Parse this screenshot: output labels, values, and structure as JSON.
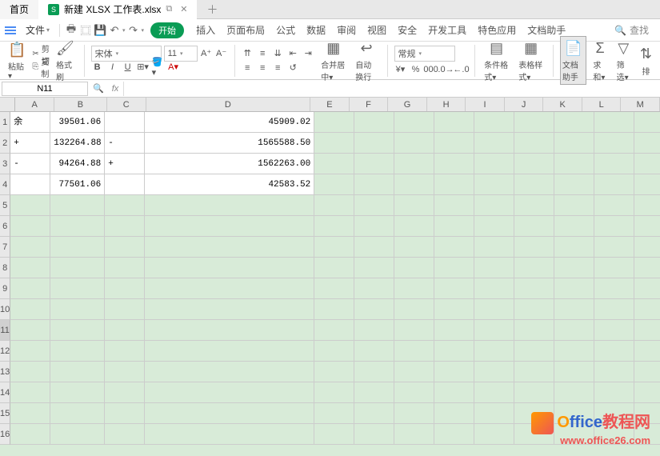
{
  "tabs": {
    "home": "首页",
    "file": "新建 XLSX 工作表.xlsx",
    "icon_letter": "S"
  },
  "menu": {
    "file": "文件",
    "start": "开始",
    "items": [
      "插入",
      "页面布局",
      "公式",
      "数据",
      "审阅",
      "视图",
      "安全",
      "开发工具",
      "特色应用",
      "文档助手"
    ],
    "search": "查找"
  },
  "toolbar": {
    "paste": "粘贴",
    "cut": "剪切",
    "copy": "复制",
    "format_painter": "格式刷",
    "font_name": "宋体",
    "font_size": "11",
    "merge": "合并居中",
    "wrap": "自动换行",
    "numfmt": "常规",
    "cond": "条件格式",
    "tablestyle": "表格样式",
    "dochelper": "文档助手",
    "sum": "求和",
    "filter": "筛选",
    "sort": "排"
  },
  "namebox": "N11",
  "fx_label": "fx",
  "colwidths": {
    "A": 50,
    "B": 68,
    "C": 50,
    "D": 212,
    "other": 50
  },
  "columns": [
    "A",
    "B",
    "C",
    "D",
    "E",
    "F",
    "G",
    "H",
    "I",
    "J",
    "K",
    "L",
    "M"
  ],
  "rows_shown": 16,
  "data_rows": 4,
  "selected_row": 11,
  "chart_data": {
    "type": "table",
    "cells": [
      {
        "r": 1,
        "c": "A",
        "v": "余",
        "t": "txt"
      },
      {
        "r": 1,
        "c": "B",
        "v": "39501.06",
        "t": "num"
      },
      {
        "r": 1,
        "c": "D",
        "v": "45909.02",
        "t": "num"
      },
      {
        "r": 2,
        "c": "A",
        "v": "+",
        "t": "txt"
      },
      {
        "r": 2,
        "c": "B",
        "v": "132264.88",
        "t": "num"
      },
      {
        "r": 2,
        "c": "C",
        "v": "-",
        "t": "txt"
      },
      {
        "r": 2,
        "c": "D",
        "v": "1565588.50",
        "t": "num"
      },
      {
        "r": 3,
        "c": "A",
        "v": "-",
        "t": "txt"
      },
      {
        "r": 3,
        "c": "B",
        "v": "94264.88",
        "t": "num"
      },
      {
        "r": 3,
        "c": "C",
        "v": "+",
        "t": "txt"
      },
      {
        "r": 3,
        "c": "D",
        "v": "1562263.00",
        "t": "num"
      },
      {
        "r": 4,
        "c": "B",
        "v": "77501.06",
        "t": "num"
      },
      {
        "r": 4,
        "c": "D",
        "v": "42583.52",
        "t": "num"
      }
    ]
  },
  "watermark": {
    "line1a": "O",
    "line1b": "ffice",
    "line1c": "教程网",
    "line2": "www.office26.com"
  }
}
